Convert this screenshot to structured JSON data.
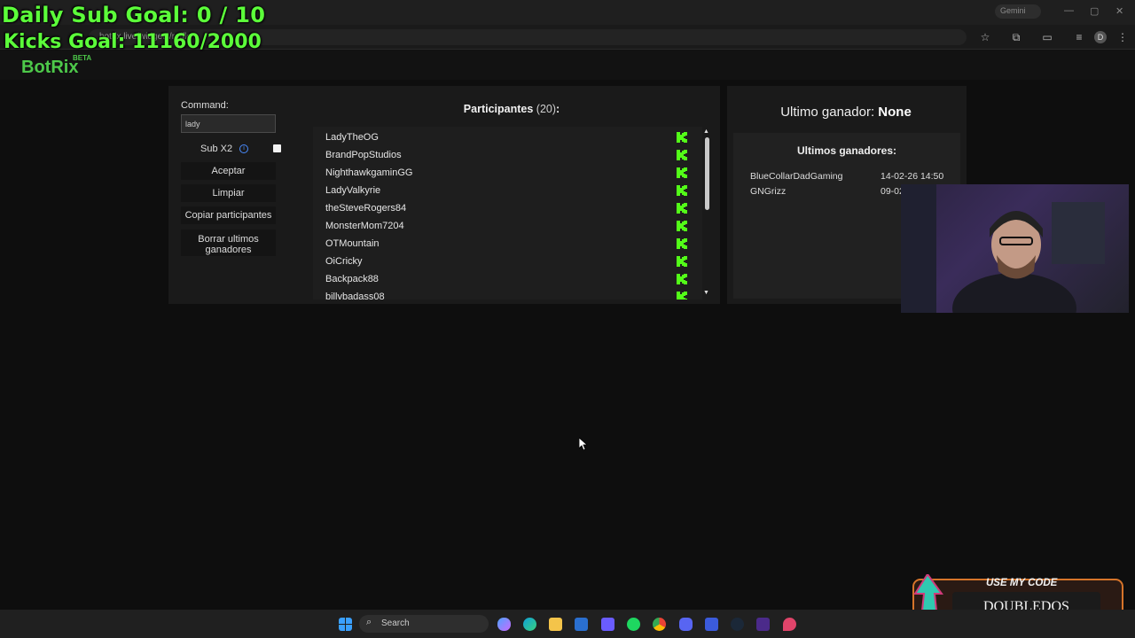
{
  "overlay": {
    "sub_goal": "Daily Sub Goal: 0 / 10",
    "kicks_goal": "Kicks Goal: 11160/2000"
  },
  "browser": {
    "url": "botrix.live/widgets/raffle",
    "chip_label": "Gemini",
    "profile_initial": "D"
  },
  "app": {
    "logo": "BotRix",
    "badge": "BETA"
  },
  "controls": {
    "command_label": "Command:",
    "command_value": "lady",
    "sub_x2_label": "Sub X2",
    "sub_x2_checked": false,
    "accept": "Aceptar",
    "clear": "Limpiar",
    "copy": "Copiar participantes",
    "delete": "Borrar ultimos ganadores"
  },
  "participants": {
    "title": "Participantes",
    "count": "(20)",
    "colon": ":",
    "list": [
      "LadyTheOG",
      "BrandPopStudios",
      "NighthawkgaminGG",
      "LadyValkyrie",
      "theSteveRogers84",
      "MonsterMom7204",
      "OTMountain",
      "OiCricky",
      "Backpack88",
      "billybadass08"
    ],
    "platform_icon": "kick-icon"
  },
  "winners": {
    "last_label": "Ultimo ganador:",
    "last_value": "None",
    "recent_title": "Ultimos ganadores:",
    "recent": [
      {
        "name": "BlueCollarDadGaming",
        "date": "14-02-26 14:50"
      },
      {
        "name": "GNGrizz",
        "date": "09-02"
      }
    ]
  },
  "promo": {
    "label": "USE MY CODE",
    "code": "DOUBLEDOS"
  },
  "taskbar": {
    "search": "Search"
  },
  "colors": {
    "kick_green": "#53fc18",
    "overlay_green": "#5cff3a",
    "brand_green": "#4dc94a"
  }
}
